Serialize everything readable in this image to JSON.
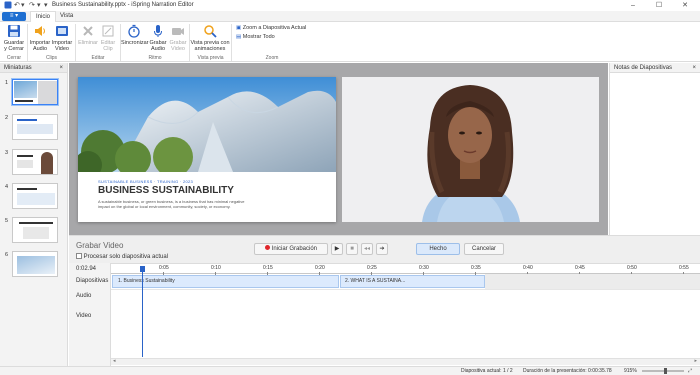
{
  "window": {
    "title": "Business Sustainability.pptx - iSpring Narration Editor",
    "controls": [
      "–",
      "☐",
      "✕"
    ]
  },
  "tabs": {
    "file": "≡ ▾",
    "home": "Inicio",
    "view": "Vista"
  },
  "ribbon": {
    "save_close": "Guardar y Cerrar",
    "import_audio": "Importar Audio",
    "import_video": "Importar Video",
    "delete": "Eliminar",
    "edit_clip": "Editar Clip",
    "sync": "Sincronizar",
    "record_audio": "Grabar Audio",
    "record_video": "Grabar Video",
    "preview_anim": "Vista previa con animaciones",
    "zoom_current": "Zoom a Diapositiva Actual",
    "show_all": "Mostrar Todo",
    "groups": {
      "close": "Cerrar",
      "clips": "Clips",
      "edit": "Editar",
      "rhythm": "Ritmo",
      "preview": "Vista previa",
      "zoom": "Zoom"
    }
  },
  "left_pane": {
    "title": "Miniaturas",
    "close": "×",
    "thumbs": [
      "1",
      "2",
      "3",
      "4",
      "5",
      "6"
    ]
  },
  "right_pane": {
    "title": "Notas de Diapositivas",
    "close": "×"
  },
  "slide": {
    "kicker": "SUSTAINABLE BUSINESS  ·  TRAINING  ·  2023",
    "title": "BUSINESS SUSTAINABILITY",
    "body": "A sustainable business, or green business, is a business that has minimal negative impact on the global or local environment, community, society, or economy."
  },
  "record": {
    "title": "Grabar Video",
    "checkbox": "Procesar solo diapositiva actual",
    "start": "Iniciar Grabación",
    "done": "Hecho",
    "cancel": "Cancelar",
    "time": "0:02.94"
  },
  "timeline": {
    "ticks": [
      "0:05",
      "0:10",
      "0:15",
      "0:20",
      "0:25",
      "0:30",
      "0:35",
      "0:40",
      "0:45",
      "0:50",
      "0:55"
    ],
    "tracks": {
      "slides": "Diapositivas",
      "audio": "Audio",
      "video": "Video"
    },
    "clips": [
      "1. Business Sustainability",
      "2. WHAT IS A SUSTAINA..."
    ]
  },
  "status": {
    "current": "Diapositiva actual: 1 / 2",
    "duration": "Duración de la presentación: 0:00:35.78",
    "zoom": "915%"
  },
  "colors": {
    "accent": "#1f6fd1",
    "clip": "#dceafd",
    "record_dot": "#e0262b"
  }
}
